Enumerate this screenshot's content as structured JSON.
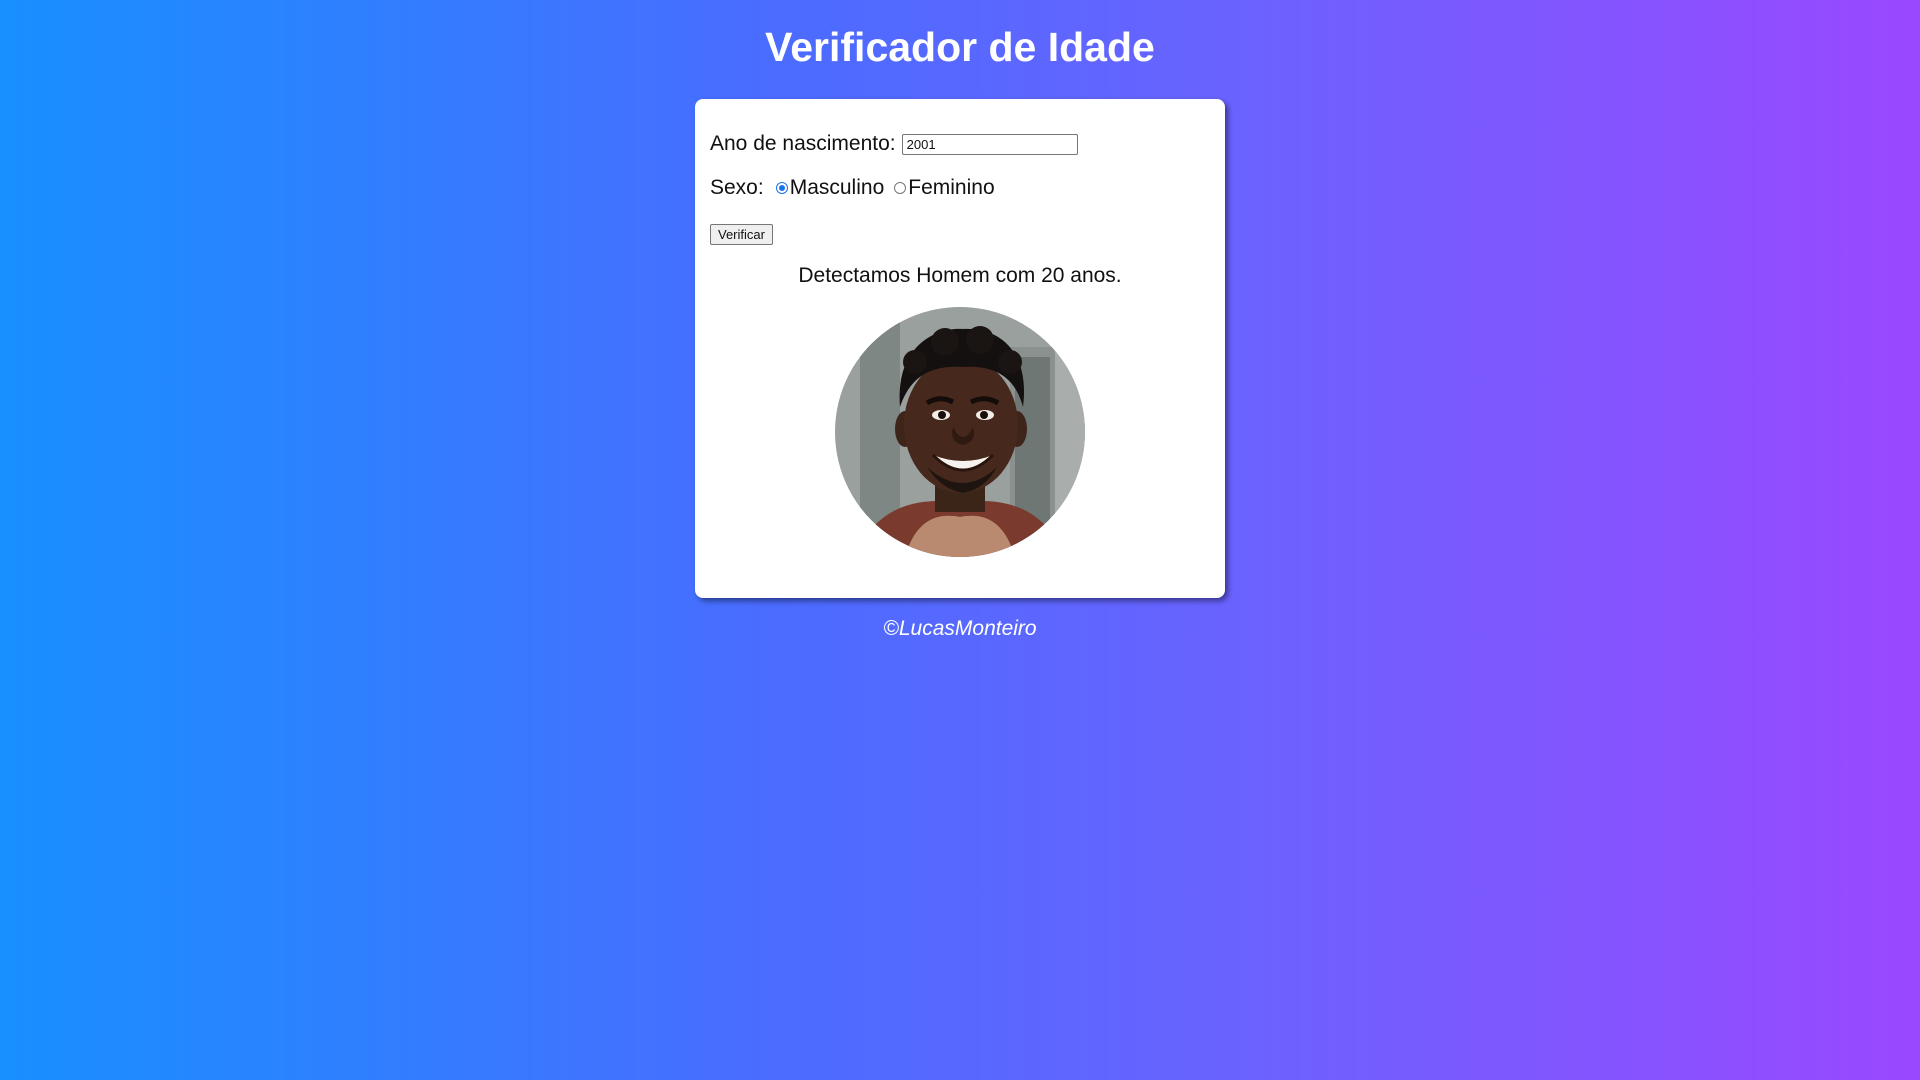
{
  "header": {
    "title": "Verificador de Idade"
  },
  "form": {
    "year_label": "Ano de nascimento:",
    "year_value": "2001",
    "sex_label": "Sexo:",
    "options": [
      {
        "label": "Masculino",
        "selected": true
      },
      {
        "label": "Feminino",
        "selected": false
      }
    ],
    "verify_label": "Verificar"
  },
  "result": {
    "text": "Detectamos Homem com 20 anos.",
    "photo": "portrait-young-man-smiling"
  },
  "footer": {
    "text": "©LucasMonteiro"
  },
  "colors": {
    "gradient_start": "#1890ff",
    "gradient_end": "#9a48ff",
    "radio_accent": "#1a73e8"
  }
}
